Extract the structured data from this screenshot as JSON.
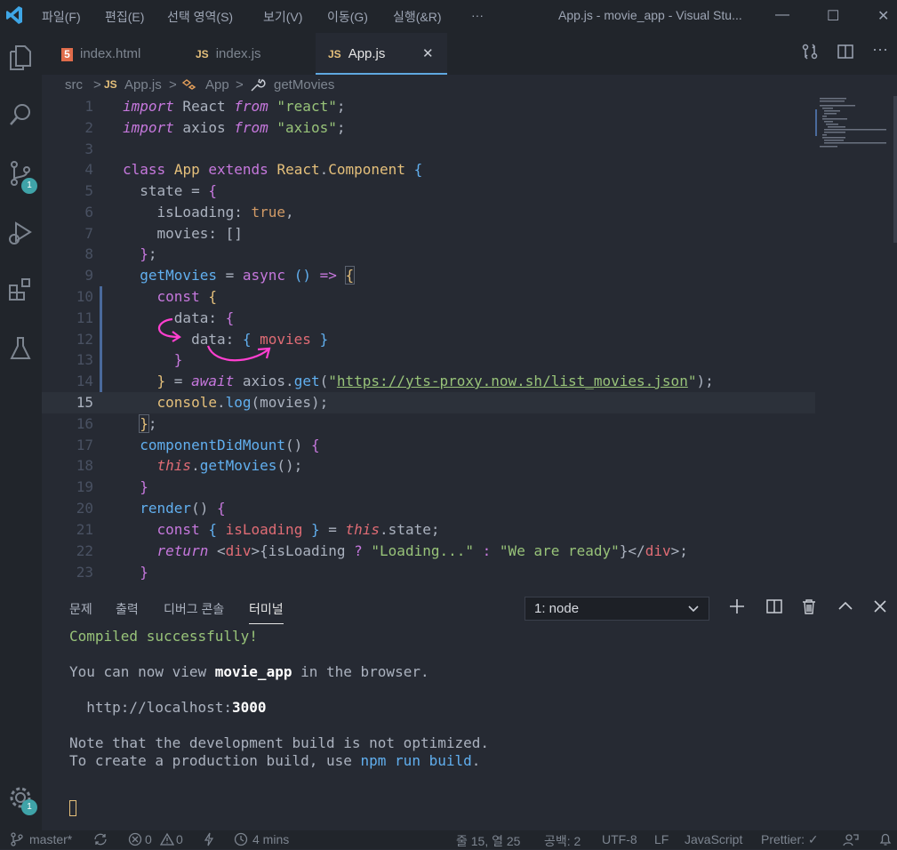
{
  "titlebar": {
    "menu": [
      "파일(F)",
      "편집(E)",
      "선택 영역(S)",
      "보기(V)",
      "이동(G)",
      "실행(&R)",
      "···"
    ],
    "window_title": "App.js - movie_app - Visual Stu...",
    "controls": {
      "minimize": "—",
      "maximize": "☐",
      "close": "✕"
    }
  },
  "activity_bar": {
    "items": [
      "explorer-icon",
      "search-icon",
      "source-control-icon",
      "run-debug-icon",
      "extensions-icon",
      "test-icon"
    ],
    "source_control_badge": "1",
    "settings_badge": "1"
  },
  "tabs": [
    {
      "label": "index.html",
      "icon": "5",
      "type": "html"
    },
    {
      "label": "index.js",
      "icon": "JS",
      "type": "js"
    },
    {
      "label": "App.js",
      "icon": "JS",
      "type": "js",
      "active": true
    }
  ],
  "tab_close": "✕",
  "breadcrumb": {
    "folder": "src",
    "sep": ">",
    "file_icon": "JS",
    "file": "App.js",
    "class": "App",
    "method": "getMovies"
  },
  "editor": {
    "line_numbers": [
      "1",
      "2",
      "3",
      "4",
      "5",
      "6",
      "7",
      "8",
      "9",
      "10",
      "11",
      "12",
      "13",
      "14",
      "15",
      "16",
      "17",
      "18",
      "19",
      "20",
      "21",
      "22",
      "23"
    ]
  },
  "panel": {
    "tabs": [
      "문제",
      "출력",
      "디버그 콘솔",
      "터미널"
    ],
    "active_tab": "터미널",
    "terminal_select": "1: node",
    "terminal": {
      "compiled": "Compiled successfully!",
      "view_prefix": "You can now view ",
      "app_name": "movie_app",
      "view_suffix": " in the browser.",
      "url_prefix": "  http://localhost:",
      "port": "3000",
      "note1": "Note that the development build is not optimized.",
      "note2_prefix": "To create a production build, use ",
      "note2_cmd": "npm run build",
      "note2_suffix": "."
    }
  },
  "status_bar": {
    "branch": "master*",
    "errors": "0",
    "warnings": "0",
    "time": "4 mins",
    "position": "줄 15, 열 25",
    "spaces": "공백: 2",
    "encoding": "UTF-8",
    "eol": "LF",
    "language": "JavaScript",
    "prettier": "Prettier: ✓"
  }
}
